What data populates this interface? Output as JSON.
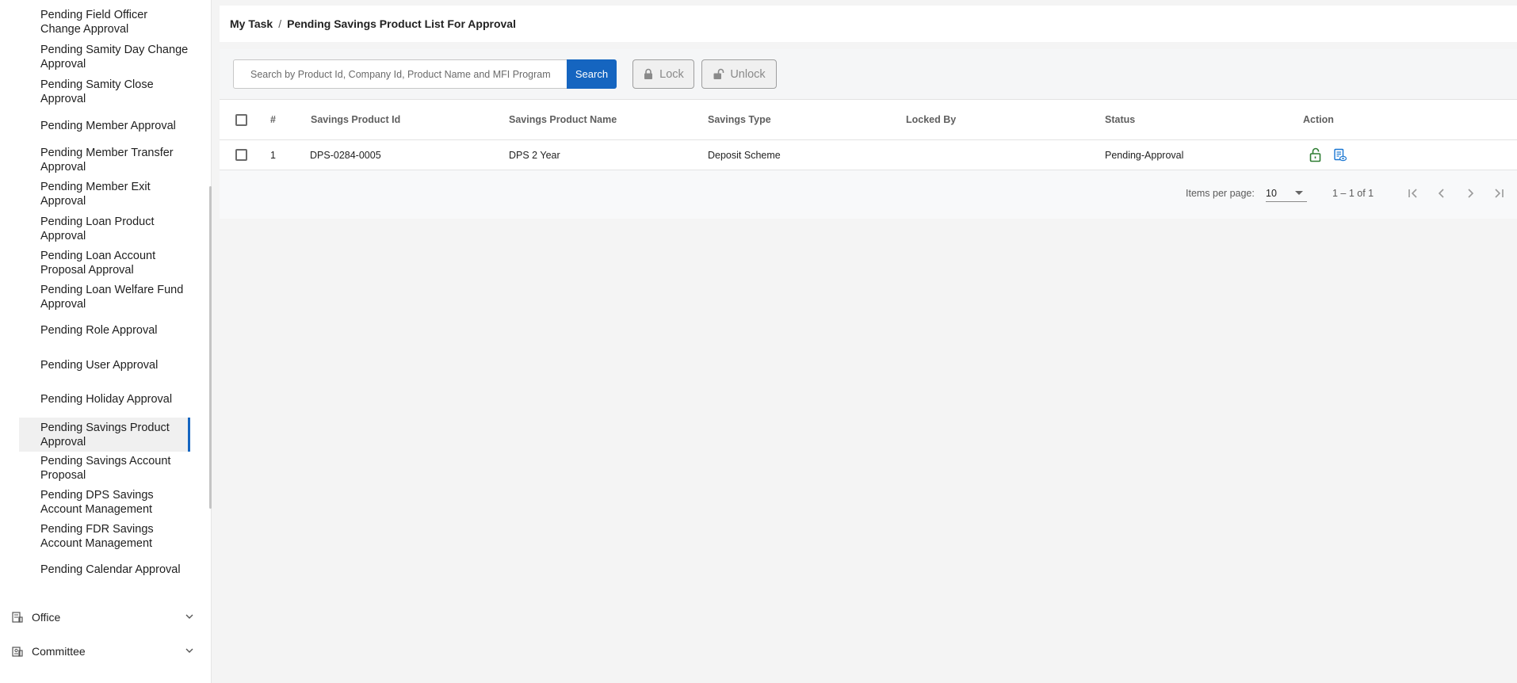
{
  "sidebar": {
    "items": [
      {
        "label": "Pending Field Officer Change Approval"
      },
      {
        "label": "Pending Samity Day Change Approval"
      },
      {
        "label": "Pending Samity Close Approval"
      },
      {
        "label": "Pending Member Approval"
      },
      {
        "label": "Pending Member Transfer Approval"
      },
      {
        "label": "Pending Member Exit Approval"
      },
      {
        "label": "Pending Loan Product Approval"
      },
      {
        "label": "Pending Loan Account Proposal Approval"
      },
      {
        "label": "Pending Loan Welfare Fund Approval"
      },
      {
        "label": "Pending Role Approval"
      },
      {
        "label": "Pending User Approval"
      },
      {
        "label": "Pending Holiday Approval"
      },
      {
        "label": "Pending Savings Product Approval"
      },
      {
        "label": "Pending Savings Account Proposal"
      },
      {
        "label": "Pending DPS Savings Account Management"
      },
      {
        "label": "Pending FDR Savings Account Management"
      },
      {
        "label": "Pending Calendar Approval"
      }
    ],
    "active_item": "Pending Savings Product Approval",
    "groups": [
      {
        "label": "Office",
        "icon": "office-icon"
      },
      {
        "label": "Committee",
        "icon": "committee-icon"
      }
    ]
  },
  "breadcrumb": {
    "root": "My Task",
    "separator": "/",
    "current": "Pending Savings Product List For Approval"
  },
  "toolbar": {
    "search_placeholder": "Search by Product Id, Company Id, Product Name and MFI Program",
    "search_value": "",
    "search_label": "Search",
    "lock_label": "Lock",
    "unlock_label": "Unlock"
  },
  "table": {
    "columns": [
      "#",
      "Savings Product Id",
      "Savings Product Name",
      "Savings Type",
      "Locked By",
      "Status",
      "Action"
    ],
    "rows": [
      {
        "index": "1",
        "product_id": "DPS-0284-0005",
        "product_name": "DPS 2 Year",
        "savings_type": "Deposit Scheme",
        "locked_by": "",
        "status": "Pending-Approval"
      }
    ]
  },
  "paginator": {
    "items_per_page_label": "Items per page:",
    "page_size": "10",
    "range_label": "1 – 1 of 1"
  },
  "colors": {
    "accent": "#1565c0",
    "icon_green": "#2e7d32",
    "icon_teal": "#1976d2"
  }
}
